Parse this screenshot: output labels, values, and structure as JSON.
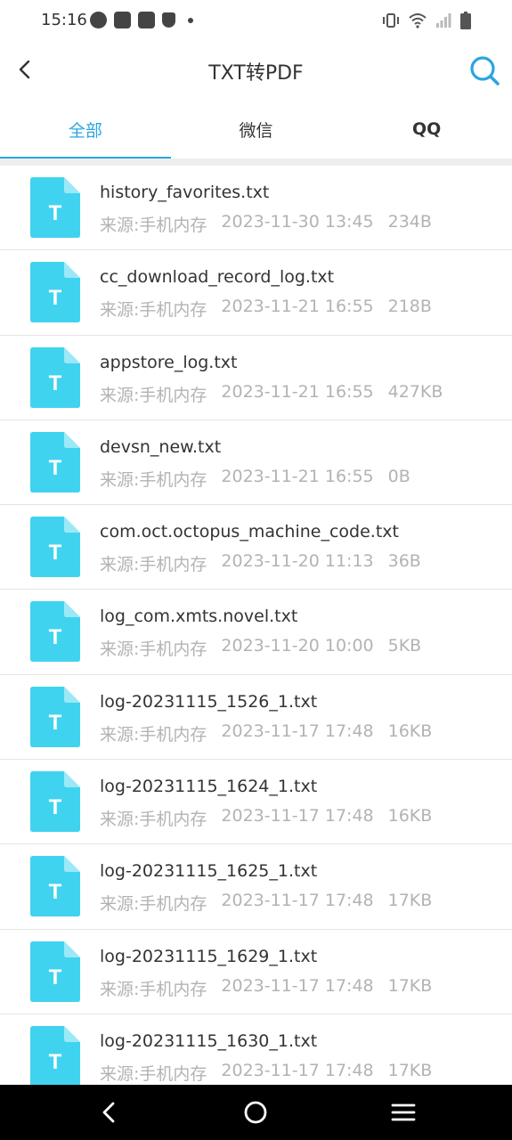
{
  "status_bar": {
    "time": "15:16"
  },
  "header": {
    "title": "TXT转PDF",
    "back_icon": "chevron-left-icon",
    "search_icon": "search-icon",
    "accent": "#2aa6e0"
  },
  "tabs": [
    {
      "label": "全部",
      "active": true
    },
    {
      "label": "微信",
      "active": false
    },
    {
      "label": "QQ",
      "active": false
    }
  ],
  "files": [
    {
      "icon": "T",
      "name": "history_favorites.txt",
      "source": "来源:手机内存",
      "date": "2023-11-30 13:45",
      "size": "234B"
    },
    {
      "icon": "T",
      "name": "cc_download_record_log.txt",
      "source": "来源:手机内存",
      "date": "2023-11-21 16:55",
      "size": "218B"
    },
    {
      "icon": "T",
      "name": "appstore_log.txt",
      "source": "来源:手机内存",
      "date": "2023-11-21 16:55",
      "size": "427KB"
    },
    {
      "icon": "T",
      "name": "devsn_new.txt",
      "source": "来源:手机内存",
      "date": "2023-11-21 16:55",
      "size": "0B"
    },
    {
      "icon": "T",
      "name": "com.oct.octopus_machine_code.txt",
      "source": "来源:手机内存",
      "date": "2023-11-20 11:13",
      "size": "36B"
    },
    {
      "icon": "T",
      "name": "log_com.xmts.novel.txt",
      "source": "来源:手机内存",
      "date": "2023-11-20 10:00",
      "size": "5KB"
    },
    {
      "icon": "T",
      "name": "log-20231115_1526_1.txt",
      "source": "来源:手机内存",
      "date": "2023-11-17 17:48",
      "size": "16KB"
    },
    {
      "icon": "T",
      "name": "log-20231115_1624_1.txt",
      "source": "来源:手机内存",
      "date": "2023-11-17 17:48",
      "size": "16KB"
    },
    {
      "icon": "T",
      "name": "log-20231115_1625_1.txt",
      "source": "来源:手机内存",
      "date": "2023-11-17 17:48",
      "size": "17KB"
    },
    {
      "icon": "T",
      "name": "log-20231115_1629_1.txt",
      "source": "来源:手机内存",
      "date": "2023-11-17 17:48",
      "size": "17KB"
    },
    {
      "icon": "T",
      "name": "log-20231115_1630_1.txt",
      "source": "来源:手机内存",
      "date": "2023-11-17 17:48",
      "size": "17KB"
    }
  ],
  "file_icon_color": "#40d3ef",
  "nav_bar": {
    "icons": [
      "back-icon",
      "home-icon",
      "menu-icon"
    ]
  }
}
